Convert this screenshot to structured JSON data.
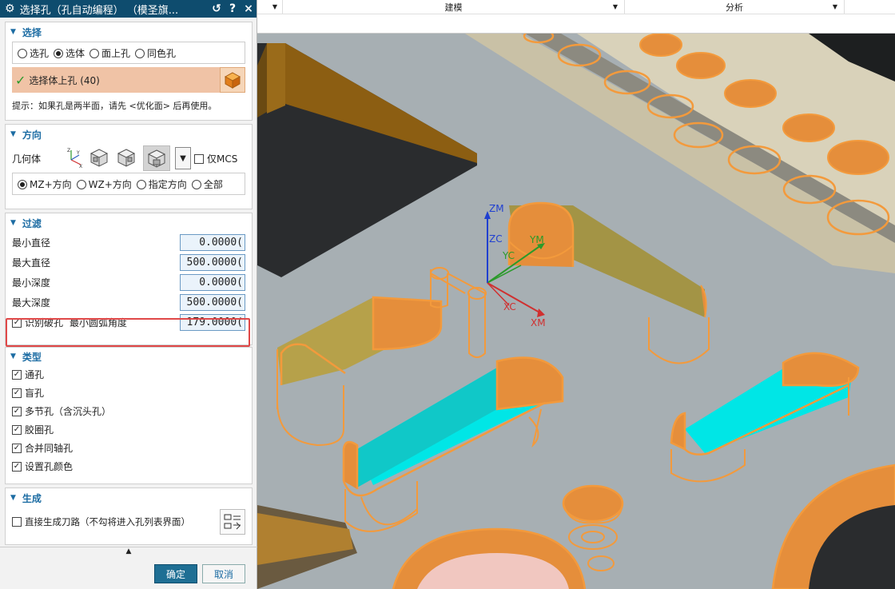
{
  "dialog": {
    "title": "选择孔（孔自动编程）  （模圣旗...",
    "buttons": {
      "reset": "↺",
      "help": "?",
      "close": "×"
    }
  },
  "selection_group": {
    "header": "选择",
    "radio_options": [
      "选孔",
      "选体",
      "面上孔",
      "同色孔"
    ],
    "selected_option": "选体",
    "select_label": "选择体上孔 (40)",
    "hint": "提示：如果孔是两半面，请先 <优化面> 后再使用。"
  },
  "direction_group": {
    "header": "方向",
    "geometry_label": "几何体",
    "mcs_only_label": "仅MCS",
    "radio_options": [
      "MZ+方向",
      "WZ+方向",
      "指定方向",
      "全部"
    ],
    "selected_option": "MZ+方向"
  },
  "filter_group": {
    "header": "过滤",
    "min_diameter_label": "最小直径",
    "min_diameter_value": "0.0000(",
    "max_diameter_label": "最大直径",
    "max_diameter_value": "500.0000(",
    "min_depth_label": "最小深度",
    "min_depth_value": "0.0000(",
    "max_depth_label": "最大深度",
    "max_depth_value": "500.0000(",
    "broken_hole_label": "识别破孔",
    "min_arc_angle_label": "最小圆弧角度",
    "min_arc_angle_value": "179.0000("
  },
  "type_group": {
    "header": "类型",
    "items": [
      {
        "label": "通孔",
        "checked": true
      },
      {
        "label": "盲孔",
        "checked": true
      },
      {
        "label": "多节孔（含沉头孔）",
        "checked": true
      },
      {
        "label": "胶圈孔",
        "checked": true
      },
      {
        "label": "合并同轴孔",
        "checked": true
      },
      {
        "label": "设置孔颜色",
        "checked": true
      }
    ]
  },
  "generate_group": {
    "header": "生成",
    "direct_toolpath_label": "直接生成刀路（不勾将进入孔列表界面）"
  },
  "footer": {
    "ok_label": "确定",
    "cancel_label": "取消"
  },
  "ribbon": {
    "tabs": [
      "",
      "建模",
      "分析",
      ""
    ]
  },
  "viewport": {
    "axis_labels": [
      "ZM",
      "ZC",
      "YM",
      "YC",
      "XC",
      "XM"
    ]
  },
  "colors": {
    "title_bar": "#0e4c6e",
    "header_text": "#1c6ca3",
    "selection_bg": "#f0c3a6",
    "highlight_orange": "#f39a3c",
    "model_gray": "#a7afb3",
    "cyan_floor": "#00e6e6",
    "red_box": "#e04848"
  }
}
